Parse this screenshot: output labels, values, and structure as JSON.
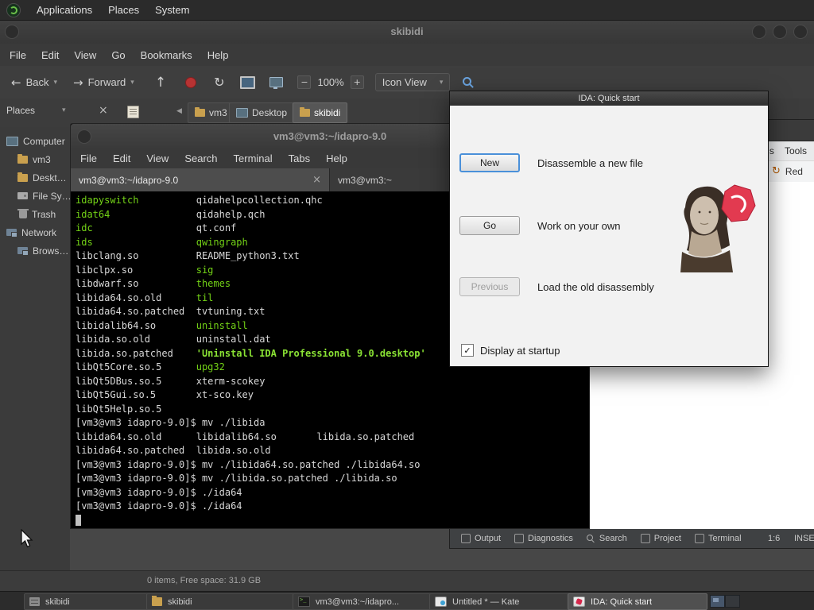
{
  "top_panel": {
    "menus": [
      "Applications",
      "Places",
      "System"
    ]
  },
  "file_manager": {
    "title": "skibidi",
    "menus": [
      "File",
      "Edit",
      "View",
      "Go",
      "Bookmarks",
      "Help"
    ],
    "toolbar": {
      "back": "Back",
      "forward": "Forward",
      "zoom": "100%",
      "view_mode": "Icon View"
    },
    "places_header": "Places",
    "path": [
      "vm3",
      "Desktop",
      "skibidi"
    ],
    "sidebar": [
      "Computer",
      "vm3",
      "Deskt…",
      "File Sy…",
      "Trash",
      "Network",
      "Brows…"
    ],
    "status": "0 items, Free space: 31.9 GB"
  },
  "terminal": {
    "title": "vm3@vm3:~/idapro-9.0",
    "menus": [
      "File",
      "Edit",
      "View",
      "Search",
      "Terminal",
      "Tabs",
      "Help"
    ],
    "tabs": [
      "vm3@vm3:~/idapro-9.0",
      "vm3@vm3:~"
    ],
    "colors": {
      "green": "#73d216",
      "bright_green": "#8ae234",
      "foreground": "#d8d8d8",
      "background": "#000000"
    },
    "lines": [
      [
        [
          "g",
          "idapyswitch"
        ],
        [
          "w",
          "          qidahelpcollection.qhc"
        ]
      ],
      [
        [
          "g",
          "idat64"
        ],
        [
          "w",
          "               qidahelp.qch"
        ]
      ],
      [
        [
          "g",
          "idc"
        ],
        [
          "w",
          "                  qt.conf"
        ]
      ],
      [
        [
          "g",
          "ids"
        ],
        [
          "w",
          "                  "
        ],
        [
          "g",
          "qwingraph"
        ]
      ],
      [
        [
          "w",
          "libclang.so          README_python3.txt"
        ]
      ],
      [
        [
          "w",
          "libclpx.so           "
        ],
        [
          "g",
          "sig"
        ]
      ],
      [
        [
          "w",
          "libdwarf.so          "
        ],
        [
          "g",
          "themes"
        ]
      ],
      [
        [
          "w",
          "libida64.so.old      "
        ],
        [
          "g",
          "til"
        ]
      ],
      [
        [
          "w",
          "libida64.so.patched  tvtuning.txt"
        ]
      ],
      [
        [
          "w",
          "libidalib64.so       "
        ],
        [
          "g",
          "uninstall"
        ]
      ],
      [
        [
          "w",
          "libida.so.old        uninstall.dat"
        ]
      ],
      [
        [
          "w",
          "libida.so.patched    "
        ],
        [
          "gb",
          "'Uninstall IDA Professional 9.0.desktop'"
        ]
      ],
      [
        [
          "w",
          "libQt5Core.so.5      "
        ],
        [
          "g",
          "upg32"
        ]
      ],
      [
        [
          "w",
          "libQt5DBus.so.5      xterm-scokey"
        ]
      ],
      [
        [
          "w",
          "libQt5Gui.so.5       xt-sco.key"
        ]
      ],
      [
        [
          "w",
          "libQt5Help.so.5"
        ]
      ],
      [
        [
          "w",
          "[vm3@vm3 idapro-9.0]$ mv ./libida"
        ]
      ],
      [
        [
          "w",
          "libida64.so.old      libidalib64.so       libida.so.patched"
        ]
      ],
      [
        [
          "w",
          "libida64.so.patched  libida.so.old"
        ]
      ],
      [
        [
          "w",
          "[vm3@vm3 idapro-9.0]$ mv ./libida64.so.patched ./libida64.so"
        ]
      ],
      [
        [
          "w",
          "[vm3@vm3 idapro-9.0]$ mv ./libida.so.patched ./libida.so"
        ]
      ],
      [
        [
          "w",
          "[vm3@vm3 idapro-9.0]$ ./ida64"
        ]
      ],
      [
        [
          "w",
          "[vm3@vm3 idapro-9.0]$ ./ida64"
        ]
      ],
      [
        [
          "cur",
          " "
        ]
      ]
    ]
  },
  "ida_dialog": {
    "title": "IDA: Quick start",
    "actions": [
      {
        "button": "New",
        "description": "Disassemble a new file"
      },
      {
        "button": "Go",
        "description": "Work on your own"
      },
      {
        "button": "Previous",
        "description": "Load the old disassembly"
      }
    ],
    "checkbox_label": "Display at startup",
    "checkbox_checked": true,
    "accent_red": "#d6274b"
  },
  "kate": {
    "menu_fragment": "s    Tools",
    "toolbar_fragment": "Red",
    "status_items": [
      "Output",
      "Diagnostics",
      "Search",
      "Project",
      "Terminal"
    ],
    "cursor_position": "1:6",
    "mode": "INSERT"
  },
  "taskbar": {
    "buttons": [
      "skibidi",
      "skibidi",
      "vm3@vm3:~/idapro...",
      "Untitled * — Kate",
      "IDA: Quick start"
    ]
  }
}
